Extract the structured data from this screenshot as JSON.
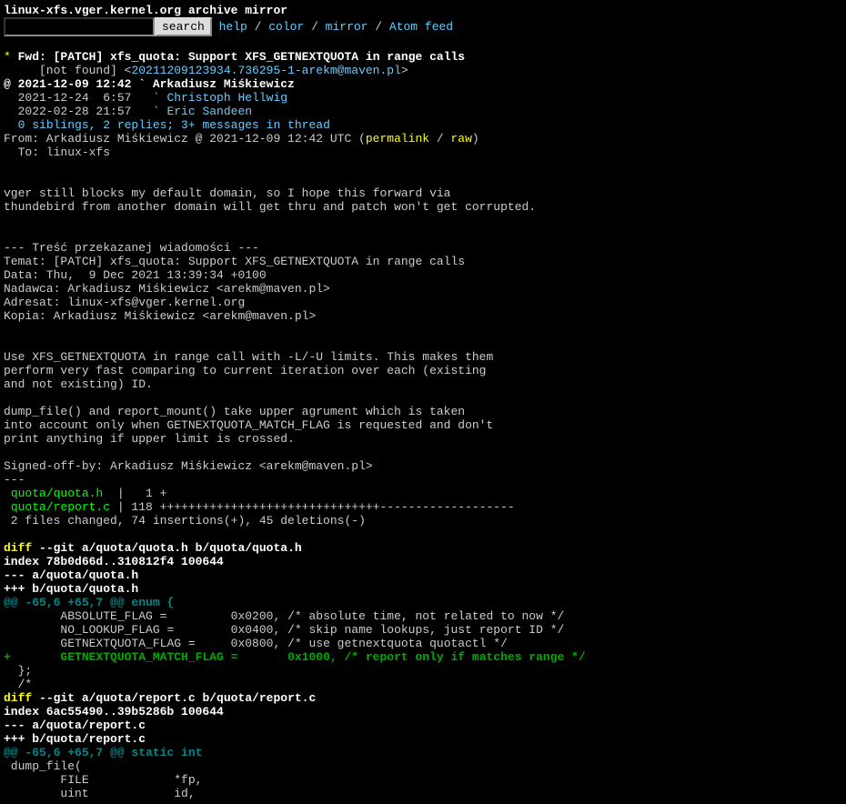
{
  "header": {
    "title": "linux-xfs.vger.kernel.org archive mirror",
    "search_button": "search",
    "nav": {
      "help": "help",
      "color": "color",
      "mirror": "mirror",
      "atom": "Atom feed",
      "sep": " / "
    }
  },
  "thread": {
    "star": "*",
    "subject": "Fwd: [PATCH] xfs_quota: Support XFS_GETNEXTQUOTA in range calls",
    "notfound_prefix": "     [not found] <",
    "msgid": "20211209123934.736295-1-arekm@maven.pl",
    "notfound_suffix": ">",
    "head": "@ 2021-12-09 12:42 ` Arkadiusz Miśkiewicz",
    "reply1_prefix": "  2021-12-24  6:57   ` ",
    "reply1_link": "Christoph Hellwig",
    "reply2_prefix": "  2022-02-28 21:57   ` ",
    "reply2_link": "Eric Sandeen",
    "siblings": "0 siblings, 2 replies; 3+ messages in thread",
    "from_prefix": "From: Arkadiusz Miśkiewicz @ 2021-12-09 12:42 UTC (",
    "permalink": "permalink",
    "from_sep": " / ",
    "raw": "raw",
    "from_suffix": ")",
    "to": "  To: linux-xfs"
  },
  "body1": "\n\nvger still blocks my default domain, so I hope this forward via\nthundebird from another domain will get thru and patch won't get corrupted.\n\n\n--- Treść przekazanej wiadomości ---\nTemat: [PATCH] xfs_quota: Support XFS_GETNEXTQUOTA in range calls\nData: Thu,  9 Dec 2021 13:39:34 +0100\nNadawca: Arkadiusz Miśkiewicz <arekm@maven.pl>\nAdresat: linux-xfs@vger.kernel.org\nKopia: Arkadiusz Miśkiewicz <arekm@maven.pl>\n\n\nUse XFS_GETNEXTQUOTA in range call with -L/-U limits. This makes them\nperform very fast comparing to current iteration over each (existing\nand not existing) ID.\n\ndump_file() and report_mount() take upper agrument which is taken\ninto account only when GETNEXTQUOTA_MATCH_FLAG is requested and don't\nprint anything if upper limit is crossed.\n\nSigned-off-by: Arkadiusz Miśkiewicz <arekm@maven.pl>\n---\n ",
  "file1": "quota/quota.h",
  "file1_stats": "  |   1 +\n ",
  "file2": "quota/report.c",
  "file2_stats": " | 118 +++++++++++++++++++++++++++++++-------------------\n 2 files changed, 74 insertions(+), 45 deletions(-)\n\n",
  "diff1_kw": "diff",
  "diff1_head": " --git a/quota/quota.h b/quota/quota.h\nindex 78b0d66d..310812f4 100644\n--- a/quota/quota.h\n+++ b/quota/quota.h",
  "hunk1": "@@ -65,6 +65,7 @@ enum {",
  "ctx1": " \tABSOLUTE_FLAG =\t\t0x0200,\t/* absolute time, not related to now */\n \tNO_LOOKUP_FLAG =\t0x0400,\t/* skip name lookups, just report ID */\n \tGETNEXTQUOTA_FLAG =\t0x0800,\t/* use getnextquota quotactl */",
  "add1": "+\tGETNEXTQUOTA_MATCH_FLAG =\t0x1000,\t/* report only if matches range */",
  "ctx2": "  };\n  /*\n",
  "diff2_kw": "diff",
  "diff2_head": " --git a/quota/report.c b/quota/report.c\nindex 6ac55490..39b5286b 100644\n--- a/quota/report.c\n+++ b/quota/report.c",
  "hunk2": "@@ -65,6 +65,7 @@ static int",
  "ctx3": " dump_file(\n \tFILE\t\t*fp,\n \tuint\t\tid,"
}
